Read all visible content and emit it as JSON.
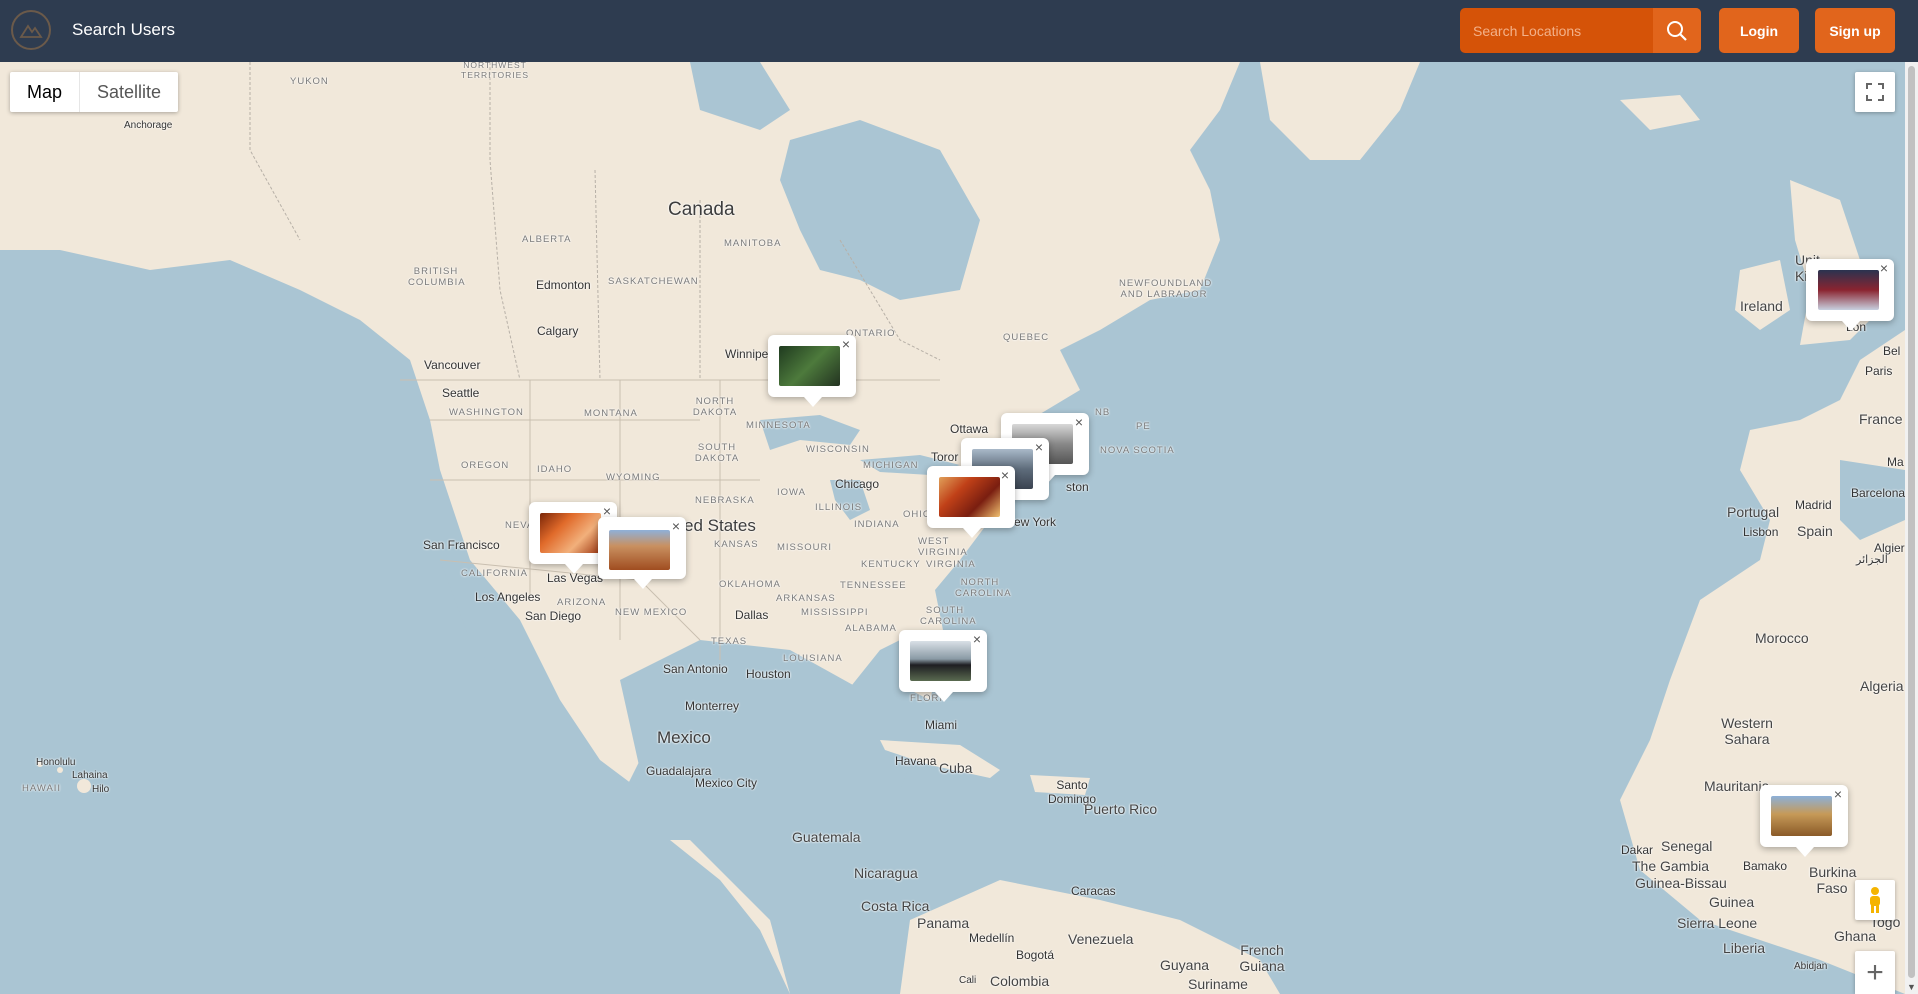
{
  "header": {
    "search_users_label": "Search Users",
    "search_placeholder": "Search Locations",
    "login_label": "Login",
    "signup_label": "Sign up",
    "colors": {
      "bar": "#2e3c50",
      "accent": "#e1651c"
    }
  },
  "map_controls": {
    "map_type_map": "Map",
    "map_type_satellite": "Satellite",
    "zoom_in_symbol": "+"
  },
  "labels": {
    "yukon": "YUKON",
    "northwest_territories": "NORTHWEST TERRITORIES",
    "anchorage": "Anchorage",
    "canada": "Canada",
    "british_columbia": "BRITISH COLUMBIA",
    "alberta": "ALBERTA",
    "saskatchewan": "SASKATCHEWAN",
    "manitoba": "MANITOBA",
    "ontario": "ONTARIO",
    "quebec": "QUEBEC",
    "newfoundland": "NEWFOUNDLAND AND LABRADOR",
    "edmonton": "Edmonton",
    "calgary": "Calgary",
    "vancouver": "Vancouver",
    "seattle": "Seattle",
    "winnipeg": "Winnipe",
    "washington": "WASHINGTON",
    "montana": "MONTANA",
    "north_dakota": "NORTH DAKOTA",
    "minnesota": "MINNESOTA",
    "oregon": "OREGON",
    "idaho": "IDAHO",
    "wyoming": "WYOMING",
    "south_dakota": "SOUTH DAKOTA",
    "wisconsin": "WISCONSIN",
    "michigan": "MICHIGAN",
    "nebraska": "NEBRASKA",
    "iowa": "IOWA",
    "illinois": "ILLINOIS",
    "indiana": "INDIANA",
    "ohio": "OHIO",
    "nevada": "NEVA",
    "united_states": "ed States",
    "kansas": "KANSAS",
    "missouri": "MISSOURI",
    "kentucky": "KENTUCKY",
    "west_virginia": "WEST VIRGINIA",
    "virginia": "VIRGINIA",
    "california": "CALIFORNIA",
    "arizona": "ARIZONA",
    "new_mexico": "NEW MEXICO",
    "oklahoma": "OKLAHOMA",
    "arkansas": "ARKANSAS",
    "tennessee": "TENNESSEE",
    "north_carolina": "NORTH CAROLINA",
    "south_carolina": "SOUTH CAROLINA",
    "mississippi": "MISSISSIPPI",
    "alabama": "ALABAMA",
    "texas": "TEXAS",
    "louisiana": "LOUISIANA",
    "florida": "FLORI",
    "nb": "NB",
    "pe": "PE",
    "nova_scotia": "NOVA SCOTIA",
    "ottawa": "Ottawa",
    "toronto": "Toror",
    "boston": "ston",
    "new_york": "ew York",
    "chicago": "Chicago",
    "san_francisco": "San Francisco",
    "las_vegas": "Las Vegas",
    "los_angeles": "Los Angeles",
    "san_diego": "San Diego",
    "dallas": "Dallas",
    "san_antonio": "San Antonio",
    "houston": "Houston",
    "monterrey": "Monterrey",
    "mexico": "Mexico",
    "guadalajara": "Guadalajara",
    "mexico_city": "Mexico City",
    "miami": "Miami",
    "havana": "Havana",
    "cuba": "Cuba",
    "santo_domingo": "Santo Domingo",
    "puerto_rico": "Puerto Rico",
    "guatemala": "Guatemala",
    "nicaragua": "Nicaragua",
    "costa_rica": "Costa Rica",
    "panama": "Panama",
    "caracas": "Caracas",
    "medellin": "Medellín",
    "venezuela": "Venezuela",
    "bogota": "Bogotá",
    "colombia": "Colombia",
    "cali": "Cali",
    "guyana": "Guyana",
    "suriname": "Suriname",
    "french_guiana": "French Guiana",
    "honolulu": "Honolulu",
    "lahaina": "Lahaina",
    "hawaii": "HAWAII",
    "hilo": "Hilo",
    "ireland": "Ireland",
    "united_kingdom": "Unit Ki",
    "london": "Lon",
    "belgium": "Bel",
    "paris": "Paris",
    "france": "France",
    "portugal": "Portugal",
    "lisbon": "Lisbon",
    "madrid": "Madrid",
    "spain": "Spain",
    "barcelona": "Barcelona",
    "ma": "Ma",
    "algiers": "Algier",
    "arabic_algiers": "الجزائر",
    "morocco": "Morocco",
    "algeria": "Algeria",
    "western_sahara": "Western Sahara",
    "mauritania": "Mauritania",
    "dakar": "Dakar",
    "senegal": "Senegal",
    "the_gambia": "The Gambia",
    "guinea_bissau": "Guinea-Bissau",
    "bamako": "Bamako",
    "guinea": "Guinea",
    "burkina_faso": "Burkina Faso",
    "sierra_leone": "Sierra Leone",
    "togo": "Togo",
    "ghana": "Ghana",
    "liberia": "Liberia",
    "abidjan": "Abidjan"
  },
  "markers": [
    {
      "name": "forest-photo",
      "close": "×"
    },
    {
      "name": "antelope-canyon-photo",
      "close": "×"
    },
    {
      "name": "grand-canyon-photo",
      "close": "×"
    },
    {
      "name": "montreal-photo",
      "close": "×"
    },
    {
      "name": "nyc-skyline-photo",
      "close": "×"
    },
    {
      "name": "autumn-street-photo",
      "close": "×"
    },
    {
      "name": "florida-birds-photo",
      "close": "×"
    },
    {
      "name": "london-stadium-photo",
      "close": "×"
    },
    {
      "name": "mali-mosque-photo",
      "close": "×"
    }
  ]
}
